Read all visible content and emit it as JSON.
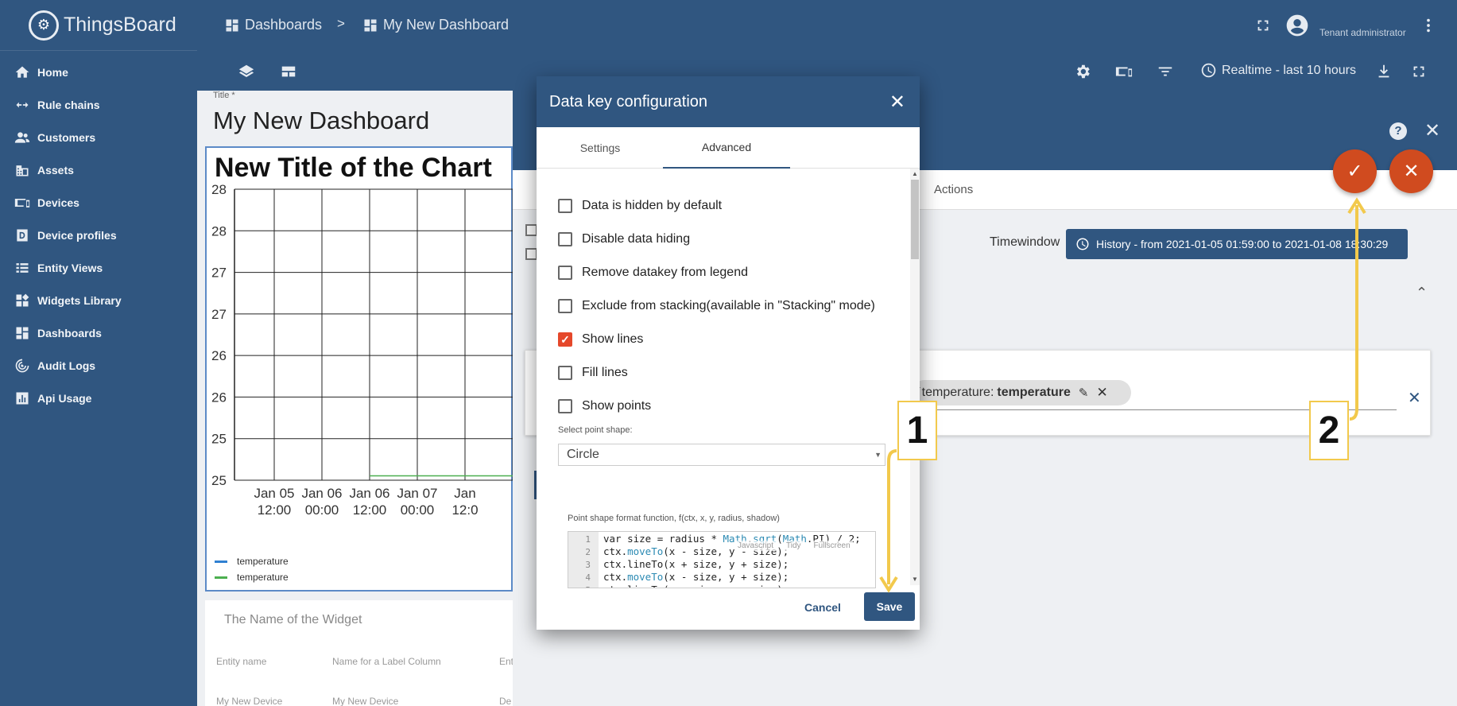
{
  "app": {
    "name": "ThingsBoard"
  },
  "sidebar": {
    "items": [
      {
        "label": "Home",
        "icon": "home-icon"
      },
      {
        "label": "Rule chains",
        "icon": "rule-chains-icon"
      },
      {
        "label": "Customers",
        "icon": "customers-icon"
      },
      {
        "label": "Assets",
        "icon": "assets-icon"
      },
      {
        "label": "Devices",
        "icon": "devices-icon"
      },
      {
        "label": "Device profiles",
        "icon": "device-profiles-icon"
      },
      {
        "label": "Entity Views",
        "icon": "entity-views-icon"
      },
      {
        "label": "Widgets Library",
        "icon": "widgets-library-icon"
      },
      {
        "label": "Dashboards",
        "icon": "dashboards-icon"
      },
      {
        "label": "Audit Logs",
        "icon": "audit-logs-icon"
      },
      {
        "label": "Api Usage",
        "icon": "api-usage-icon"
      }
    ]
  },
  "topbar": {
    "breadcrumb": [
      "Dashboards",
      "My New Dashboard"
    ],
    "separator": ">",
    "user_role": "Tenant administrator"
  },
  "toolbar": {
    "timewindow": "Realtime - last 10 hours"
  },
  "dashboard": {
    "title_label": "Title *",
    "title": "My New Dashboard",
    "chart_widget": {
      "title": "New Title of the Chart",
      "legend": [
        {
          "label": "temperature",
          "color": "#2f80d1"
        },
        {
          "label": "temperature",
          "color": "#4caf50"
        }
      ]
    },
    "table_widget": {
      "title": "The Name of the Widget",
      "columns": [
        "Entity name",
        "Name for a Label Column",
        "Ent"
      ],
      "row": [
        "My New Device",
        "My New Device",
        "De"
      ]
    }
  },
  "chart_data": {
    "type": "line",
    "title": "New Title of the Chart",
    "y_ticks": [
      "28",
      "28",
      "27",
      "27",
      "26",
      "26",
      "25",
      "25"
    ],
    "x_ticks": [
      {
        "top": "Jan 05",
        "bottom": "12:00"
      },
      {
        "top": "Jan 06",
        "bottom": "00:00"
      },
      {
        "top": "Jan 06",
        "bottom": "12:00"
      },
      {
        "top": "Jan 07",
        "bottom": "00:00"
      },
      {
        "top": "Jan",
        "bottom": "12:0"
      }
    ],
    "series": [
      {
        "name": "temperature",
        "color": "#2f80d1",
        "values": []
      },
      {
        "name": "temperature",
        "color": "#4caf50",
        "values": [
          25.1,
          25.1,
          25.1
        ]
      }
    ],
    "grid": true
  },
  "editor": {
    "actions_tab": "Actions",
    "timewindow_label": "Timewindow",
    "timewindow_value": "History - from 2021-01-05 01:59:00 to 2021-01-08 18:30:29",
    "key_chip": {
      "label": "temperature:",
      "key": "temperature"
    }
  },
  "dialog": {
    "title": "Data key configuration",
    "tabs": [
      "Settings",
      "Advanced"
    ],
    "active_tab": "Advanced",
    "checkboxes": [
      {
        "label": "Data is hidden by default",
        "checked": false
      },
      {
        "label": "Disable data hiding",
        "checked": false
      },
      {
        "label": "Remove datakey from legend",
        "checked": false
      },
      {
        "label": "Exclude from stacking(available in \"Stacking\" mode)",
        "checked": false
      },
      {
        "label": "Show lines",
        "checked": true
      },
      {
        "label": "Fill lines",
        "checked": false
      },
      {
        "label": "Show points",
        "checked": false
      }
    ],
    "point_shape_label": "Select point shape:",
    "point_shape_value": "Circle",
    "function_label": "Point shape format function, f(ctx, x, y, radius, shadow)",
    "code_tools": [
      "Javascript",
      "Tidy",
      "Fullscreen"
    ],
    "code_lines": [
      "var size = radius * Math.sqrt(Math.PI) / 2;",
      "ctx.moveTo(x - size, y - size);",
      "ctx.lineTo(x + size, y + size);",
      "ctx.moveTo(x - size, y + size);",
      "ctx.lineTo(x + size, y - size);"
    ],
    "cancel_label": "Cancel",
    "save_label": "Save"
  },
  "annotations": {
    "step1": "1",
    "step2": "2"
  },
  "colors": {
    "primary": "#305680",
    "accent": "#e5482b",
    "fab": "#d04b1f",
    "annotation": "#f2c94c"
  }
}
